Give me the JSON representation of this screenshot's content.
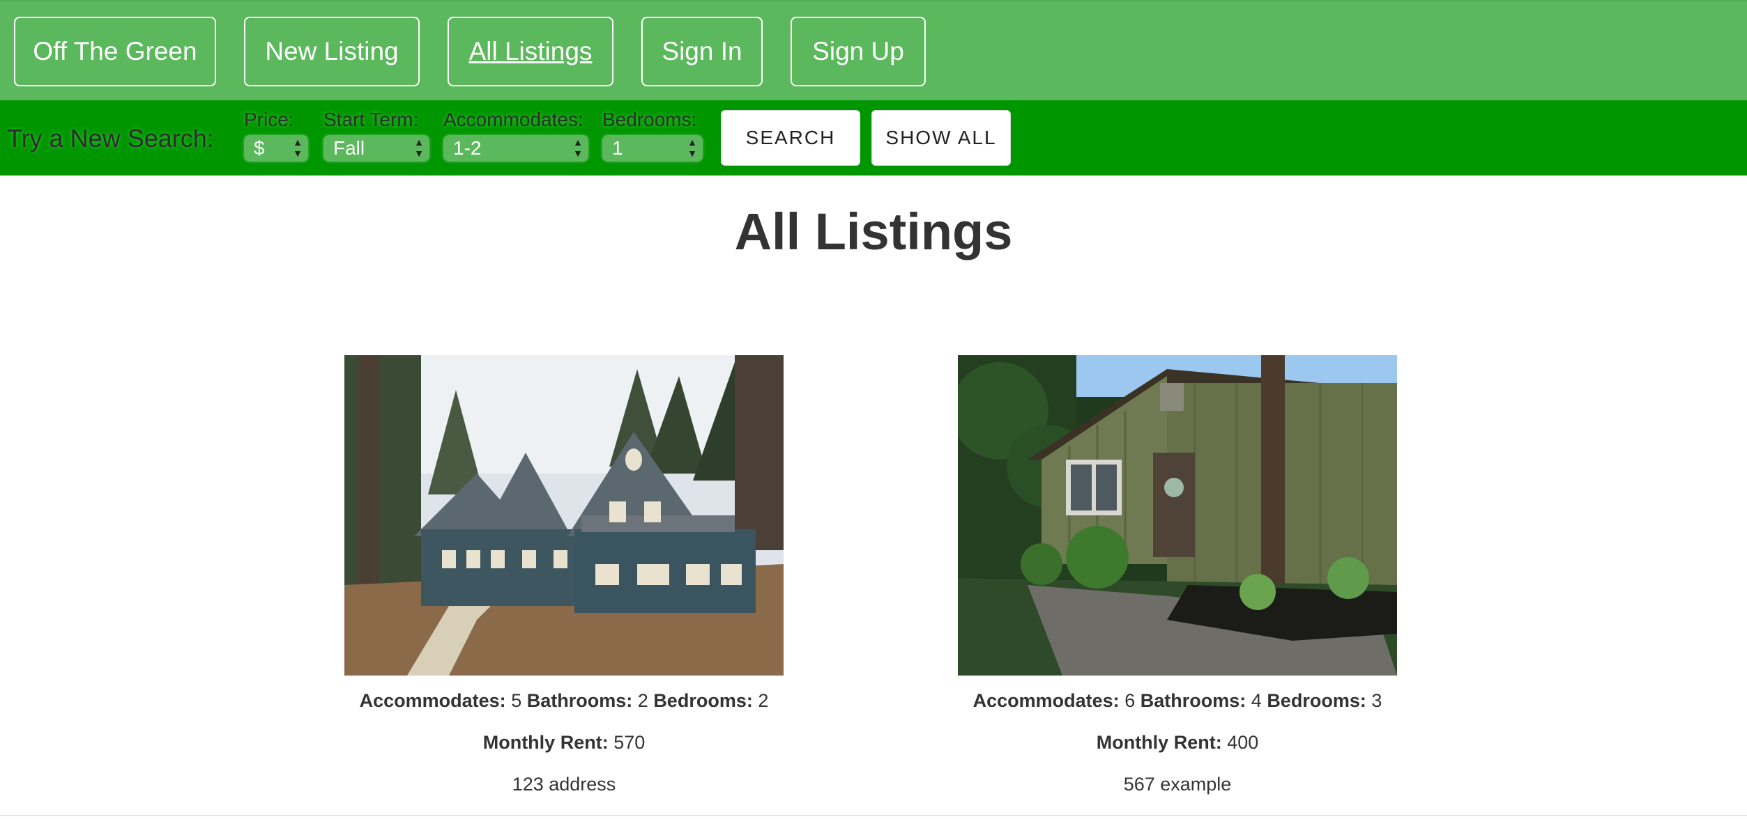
{
  "nav": {
    "brand": "Off The Green",
    "new_listing": "New Listing",
    "all_listings": "All Listings",
    "sign_in": "Sign In",
    "sign_up": "Sign Up"
  },
  "search": {
    "label": "Try a New Search:",
    "price": {
      "label": "Price:",
      "value": "$"
    },
    "start_term": {
      "label": "Start Term:",
      "value": "Fall"
    },
    "accommodates": {
      "label": "Accommodates:",
      "value": "1-2"
    },
    "bedrooms": {
      "label": "Bedrooms:",
      "value": "1"
    },
    "search_button": "SEARCH",
    "show_all_button": "SHOW ALL"
  },
  "page": {
    "title": "All Listings"
  },
  "listings": [
    {
      "accommodates_label": "Accommodates:",
      "accommodates": "5",
      "bathrooms_label": "Bathrooms:",
      "bathrooms": "2",
      "bedrooms_label": "Bedrooms:",
      "bedrooms": "2",
      "rent_label": "Monthly Rent:",
      "rent": "570",
      "address": "123 address"
    },
    {
      "accommodates_label": "Accommodates:",
      "accommodates": "6",
      "bathrooms_label": "Bathrooms:",
      "bathrooms": "4",
      "bedrooms_label": "Bedrooms:",
      "bedrooms": "3",
      "rent_label": "Monthly Rent:",
      "rent": "400",
      "address": "567 example"
    }
  ],
  "colors": {
    "nav_bg": "#5cb85c",
    "search_bg": "#009600",
    "text": "#333333"
  }
}
